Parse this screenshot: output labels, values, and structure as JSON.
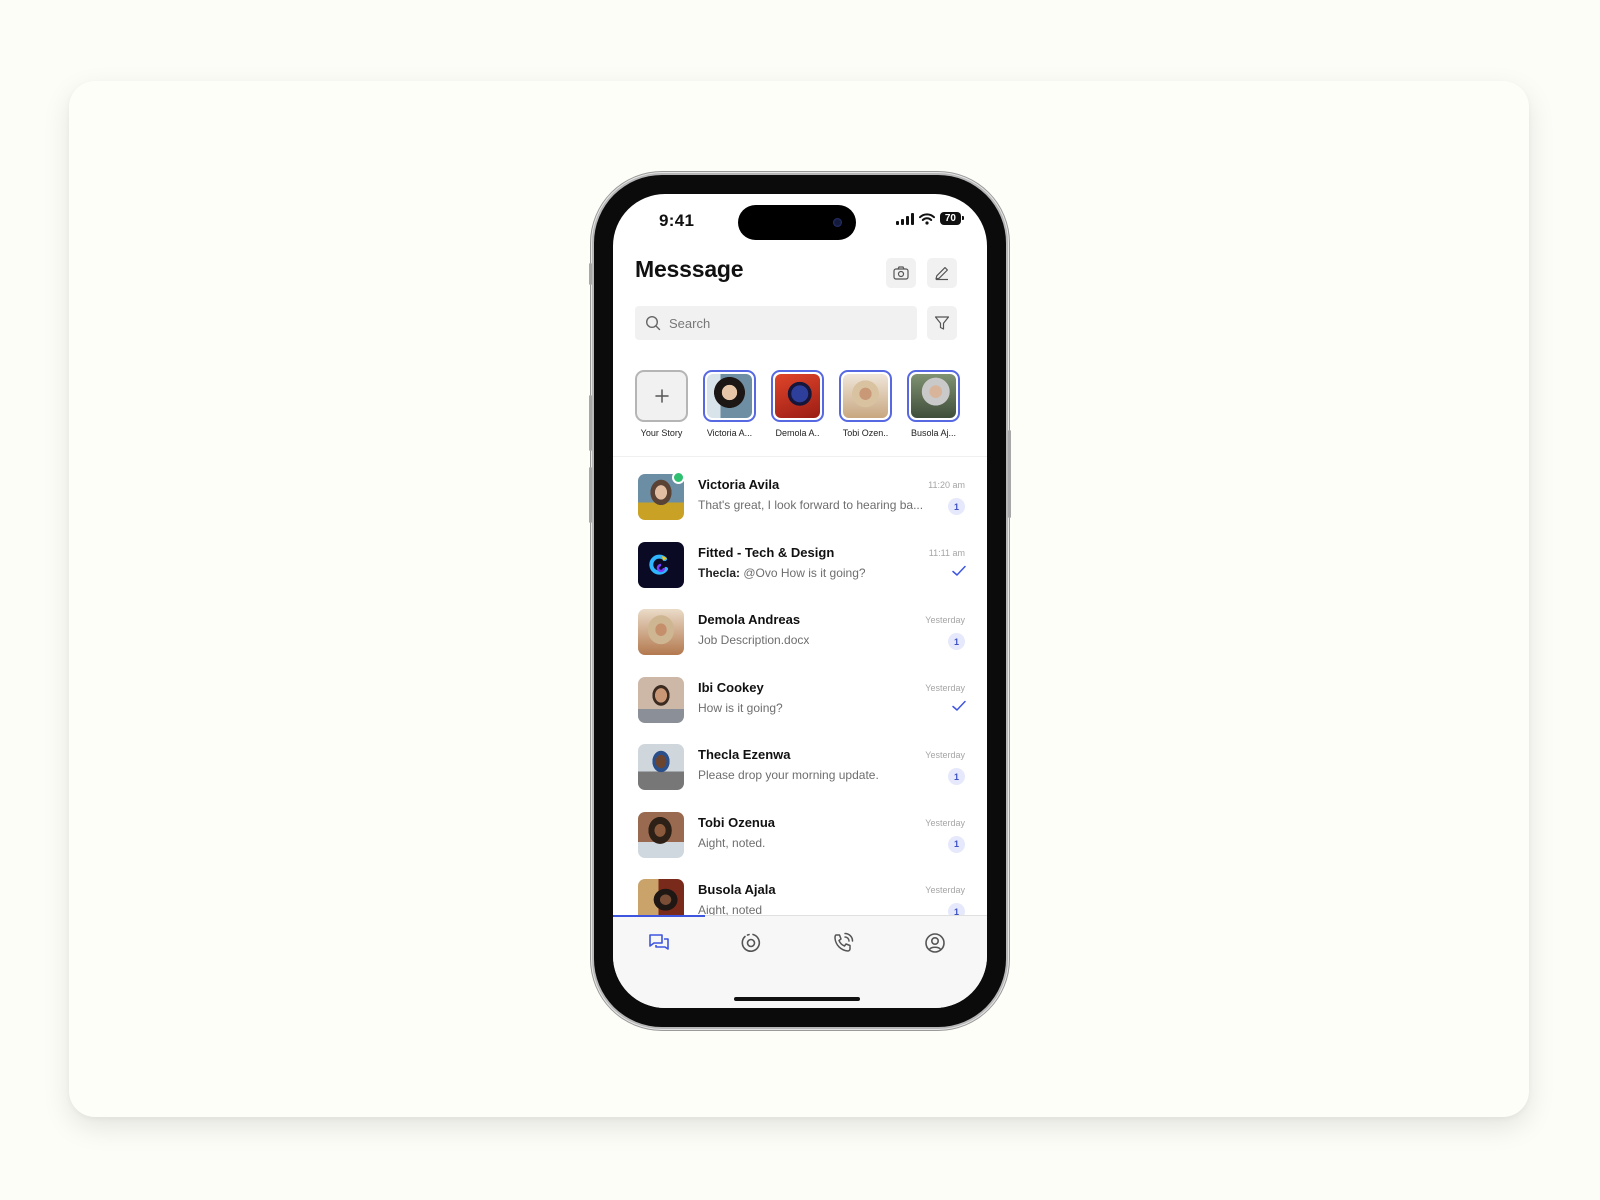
{
  "status_bar": {
    "time": "9:41",
    "battery": "70"
  },
  "header": {
    "title": "Messsage",
    "camera_button": "camera-icon",
    "compose_button": "edit-icon"
  },
  "search": {
    "placeholder": "Search",
    "value": "",
    "filter_button": "filter-icon"
  },
  "stories": [
    {
      "label": "Your Story",
      "own": true
    },
    {
      "label": "Victoria A..."
    },
    {
      "label": "Demola A.."
    },
    {
      "label": "Tobi Ozen.."
    },
    {
      "label": "Busola Aj..."
    }
  ],
  "chats": [
    {
      "name": "Victoria Avila",
      "preview": "That's great, I look forward to hearing ba...",
      "time": "11:20 am",
      "unread": "1",
      "online": true
    },
    {
      "name": "Fitted - Tech & Design",
      "sender": "Thecla:",
      "preview": " @Ovo How is it going?",
      "time": "11:11 am",
      "status": "sent"
    },
    {
      "name": "Demola Andreas",
      "preview": "Job Description.docx",
      "time": "Yesterday",
      "unread": "1"
    },
    {
      "name": "Ibi Cookey",
      "preview": "How is it going?",
      "time": "Yesterday",
      "status": "sent"
    },
    {
      "name": "Thecla Ezenwa",
      "preview": "Please drop your morning update.",
      "time": "Yesterday",
      "unread": "1"
    },
    {
      "name": "Tobi Ozenua",
      "preview": "Aight, noted.",
      "time": "Yesterday",
      "unread": "1"
    },
    {
      "name": "Busola Ajala",
      "preview": "Aight, noted",
      "time": "Yesterday",
      "unread": "1"
    }
  ],
  "tabbar": {
    "active": "messages",
    "tabs": [
      {
        "id": "messages",
        "icon": "chat-bubbles-icon"
      },
      {
        "id": "status",
        "icon": "status-icon"
      },
      {
        "id": "calls",
        "icon": "phone-icon"
      },
      {
        "id": "profile",
        "icon": "profile-icon"
      }
    ]
  },
  "colors": {
    "accent": "#3e55e0",
    "online": "#2fbf71",
    "badge_bg": "#e6e9fb"
  }
}
